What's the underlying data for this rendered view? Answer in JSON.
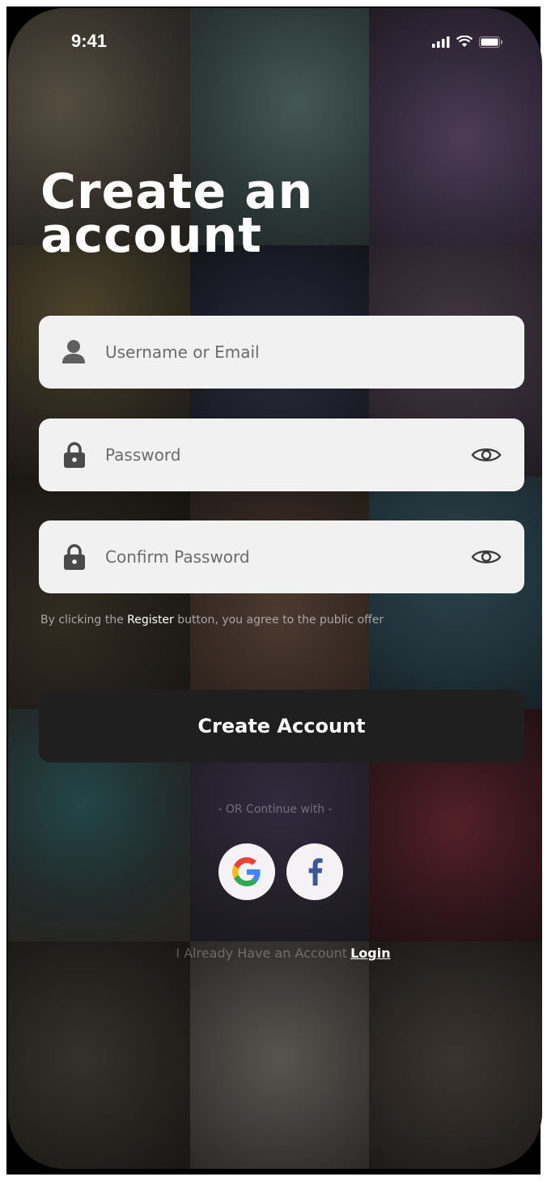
{
  "status_bar": {
    "time": "9:41"
  },
  "heading": {
    "line1": "Create an",
    "line2": "account"
  },
  "form": {
    "username": {
      "placeholder": "Username or Email",
      "icon": "person-icon"
    },
    "password": {
      "placeholder": "Password",
      "icon": "lock-icon",
      "toggle_icon": "eye-icon"
    },
    "confirm_password": {
      "placeholder": "Confirm Password",
      "icon": "lock-icon",
      "toggle_icon": "eye-icon"
    }
  },
  "terms": {
    "prefix": "By clicking the ",
    "highlight": "Register",
    "suffix": " button, you agree to the public offer"
  },
  "create_button": {
    "label": "Create Account"
  },
  "divider": {
    "label": "- OR Continue with -"
  },
  "social": [
    {
      "name": "google",
      "icon": "google-icon",
      "color": "#EA4335"
    },
    {
      "name": "facebook",
      "icon": "facebook-icon",
      "color": "#3B5998"
    }
  ],
  "footer": {
    "prompt": "I Already Have an Account",
    "link": "Login"
  },
  "colors": {
    "field_bg": "#F2F1F1",
    "button_bg": "#1F1F1F",
    "text_primary": "#FFFFFF"
  }
}
